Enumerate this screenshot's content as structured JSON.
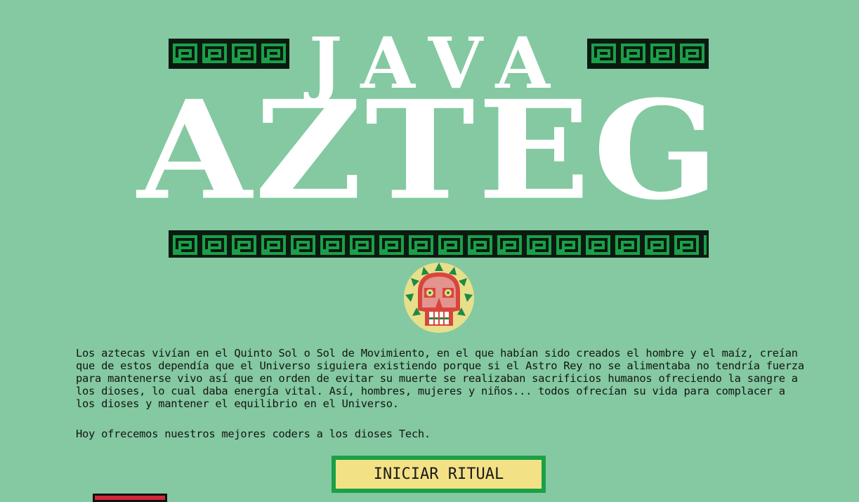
{
  "title": {
    "line1": "JAVA",
    "line2": "AZTEG"
  },
  "intro": {
    "paragraph": "Los aztecas vivían en el Quinto Sol o Sol de Movimiento, en el que habían sido creados el hombre y el maíz, creían que de estos dependía que el Universo siguiera existiendo porque si el Astro Rey no se alimentaba no tendría fuerza para mantenerse vivo así que en orden de evitar su muerte se realizaban sacrificios humanos ofreciendo la sangre a los dioses, lo cual daba energía vital. Así, hombres, mujeres y niños... todos ofrecían su vida para complacer a los dioses y mantener el equilibrio en el Universo.",
    "tagline": "Hoy ofrecemos nuestros mejores coders a los dioses Tech."
  },
  "actions": {
    "start_ritual_label": "INICIAR RITUAL"
  },
  "colors": {
    "background": "#84c9a1",
    "border_pattern": "#1aa049",
    "button_fill": "#f3e186",
    "button_border": "#1aa049",
    "skull_red": "#d8453c"
  },
  "icons": {
    "mascot": "aztec-skull-icon",
    "pattern": "greek-key-icon"
  }
}
